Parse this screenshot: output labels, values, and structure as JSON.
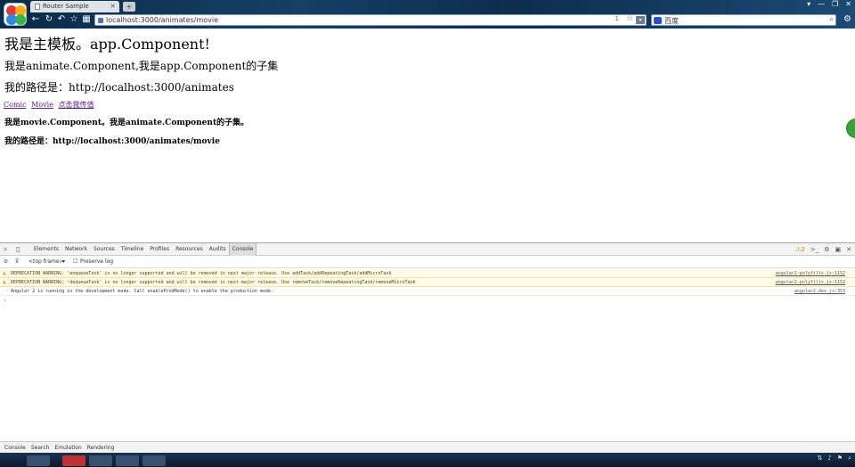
{
  "browser": {
    "tab_title": "Router Sample",
    "tab_close": "×",
    "new_tab": "+",
    "url": "localhost:3000/animates/movie",
    "omnibox_number": "1",
    "search_placeholder": "百度",
    "window_controls": [
      "▾",
      "—",
      "❐",
      "✕"
    ],
    "icons": [
      "back-icon",
      "forward-icon",
      "reload-icon",
      "star-icon",
      "apps-icon",
      "search-icon",
      "wrench-icon"
    ]
  },
  "page": {
    "h1": "我是主模板。app.Component!",
    "h2_component": "我是animate.Component,我是app.Component的子集",
    "h2_path": "我的路径是：http://localhost:3000/animates",
    "links": [
      "Comic",
      "Movie",
      "点击我传值"
    ],
    "h3_component": "我是movie.Component。我是animate.Component的子集。",
    "h3_path": "我的路径是：http://localhost:3000/animates/movie"
  },
  "devtools": {
    "tabs": [
      "Elements",
      "Network",
      "Sources",
      "Timeline",
      "Profiles",
      "Resources",
      "Audits",
      "Console"
    ],
    "active_tab": "Console",
    "warning_count": "2",
    "frame_selector": "<top frame>",
    "preserve_log": "Preserve log",
    "logs": [
      {
        "level": "warn",
        "text": "DEPRECATION WARNING: 'enqueueTask' is no longer supported and will be removed in next major release. Use addTask/addRepeatingTask/addMicroTask",
        "source": "angular2-polyfills.js:1152"
      },
      {
        "level": "warn",
        "text": "DEPRECATION WARNING: 'dequeueTask' is no longer supported and will be removed in next major release. Use removeTask/removeRepeatingTask/removeMicroTask",
        "source": "angular2-polyfills.js:1152"
      },
      {
        "level": "info",
        "text": "Angular 2 is running in the development mode. Call enableProdMode() to enable the production mode.",
        "source": "angular2.dev.js:353"
      }
    ],
    "prompt": "›",
    "drawer_tabs": [
      "Console",
      "Search",
      "Emulation",
      "Rendering"
    ]
  },
  "colors": {
    "link": "#551a8b",
    "warning_bg": "#fffbe6",
    "warning_icon": "#e5a000"
  }
}
